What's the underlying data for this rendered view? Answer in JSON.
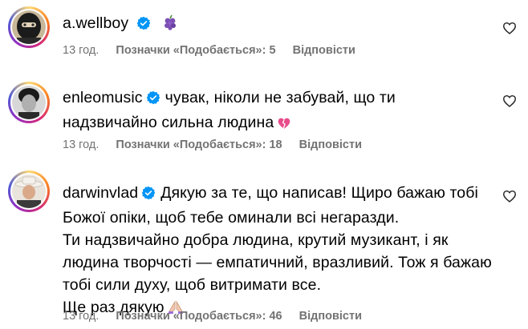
{
  "comments": [
    {
      "username": "a.wellboy",
      "text": "",
      "emoji": "grape-emoji",
      "time": "13 год.",
      "likes": "Позначки «Подобається»: 5",
      "reply": "Відповісти"
    },
    {
      "username": "enleomusic",
      "text": "чувак, ніколи не забувай, що ти надзвичайно сильна людина",
      "emoji": "broken-heart-emoji",
      "time": "13 год.",
      "likes": "Позначки «Подобається»: 18",
      "reply": "Відповісти"
    },
    {
      "username": "darwinvlad",
      "lines": [
        "Дякую за те, що написав! Щиро бажаю тобі",
        "Божої опіки, щоб тебе оминали всі негаразди.",
        "Ти надзвичайно добра людина, крутий музикант, і як",
        "людина творчості — емпатичний, вразливий. Тож я бажаю",
        "тобі сили духу, щоб витримати все.",
        "Ще раз дякую"
      ],
      "emoji": "praying-hands-emoji",
      "time": "13 год.",
      "likes": "Позначки «Подобається»: 46",
      "reply": "Відповісти"
    }
  ],
  "colors": {
    "verified": "#0095f6",
    "meta": "#737373",
    "broken_heart": "#e84c8b",
    "grape": "#7b4fb3"
  }
}
